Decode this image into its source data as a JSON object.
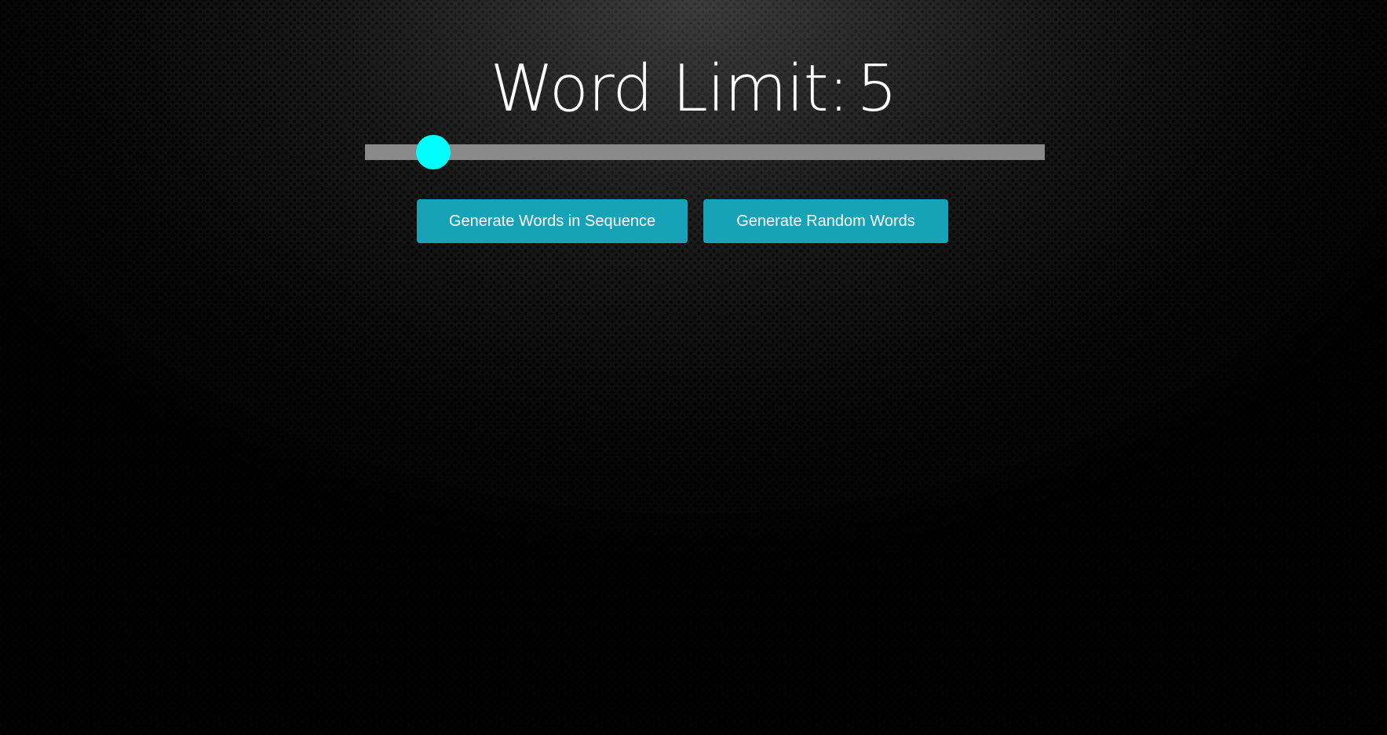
{
  "word_limit": {
    "label": "Word Limit:",
    "value": "5"
  },
  "slider": {
    "fraction": 0.101,
    "thumb_color": "#00ffff",
    "track_color": "#8a8a8a"
  },
  "buttons": {
    "sequence_label": "Generate Words in Sequence",
    "random_label": "Generate Random Words",
    "color": "#17a2b8"
  }
}
